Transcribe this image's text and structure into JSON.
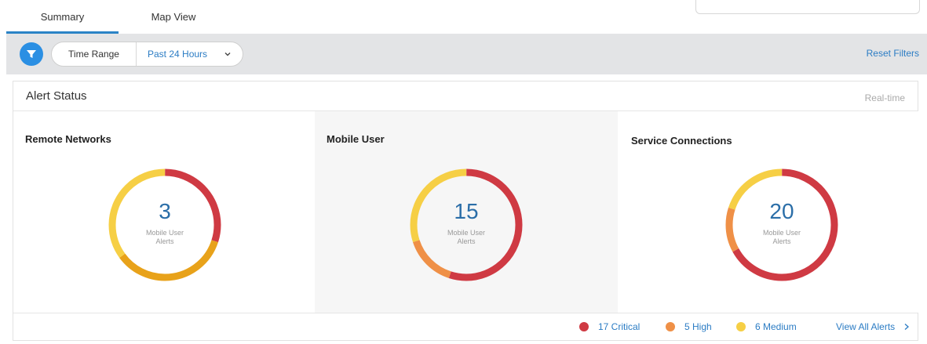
{
  "tabs": [
    {
      "label": "Summary",
      "active": true
    },
    {
      "label": "Map View",
      "active": false
    }
  ],
  "filters": {
    "filter_icon": "funnel-icon",
    "time_range_label": "Time Range",
    "time_range_value": "Past 24 Hours",
    "reset_label": "Reset Filters"
  },
  "alert_status": {
    "title": "Alert Status",
    "mode": "Real-time",
    "panels": [
      {
        "title": "Remote Networks",
        "count": "3",
        "caption": "Mobile User Alerts",
        "fractions": {
          "critical": 0.3,
          "high": 0.35,
          "medium": 0.35
        }
      },
      {
        "title": "Mobile User",
        "count": "15",
        "caption": "Mobile User Alerts",
        "fractions": {
          "critical": 0.55,
          "high": 0.15,
          "medium": 0.3
        }
      },
      {
        "title": "Service Connections",
        "count": "20",
        "caption": "Mobile User Alerts",
        "fractions": {
          "critical": 0.67,
          "high": 0.13,
          "medium": 0.2
        }
      }
    ],
    "legend": [
      {
        "label": "17 Critical",
        "color": "#cf3a43"
      },
      {
        "label": "5 High",
        "color": "#ef9047"
      },
      {
        "label": "6 Medium",
        "color": "#f6cf45"
      }
    ],
    "view_all_label": "View All Alerts"
  },
  "colors": {
    "accent": "#2b83c6",
    "critical": "#cf3a43",
    "high_remote": "#e8a21a",
    "high": "#ef9047",
    "medium": "#f6cf45"
  }
}
